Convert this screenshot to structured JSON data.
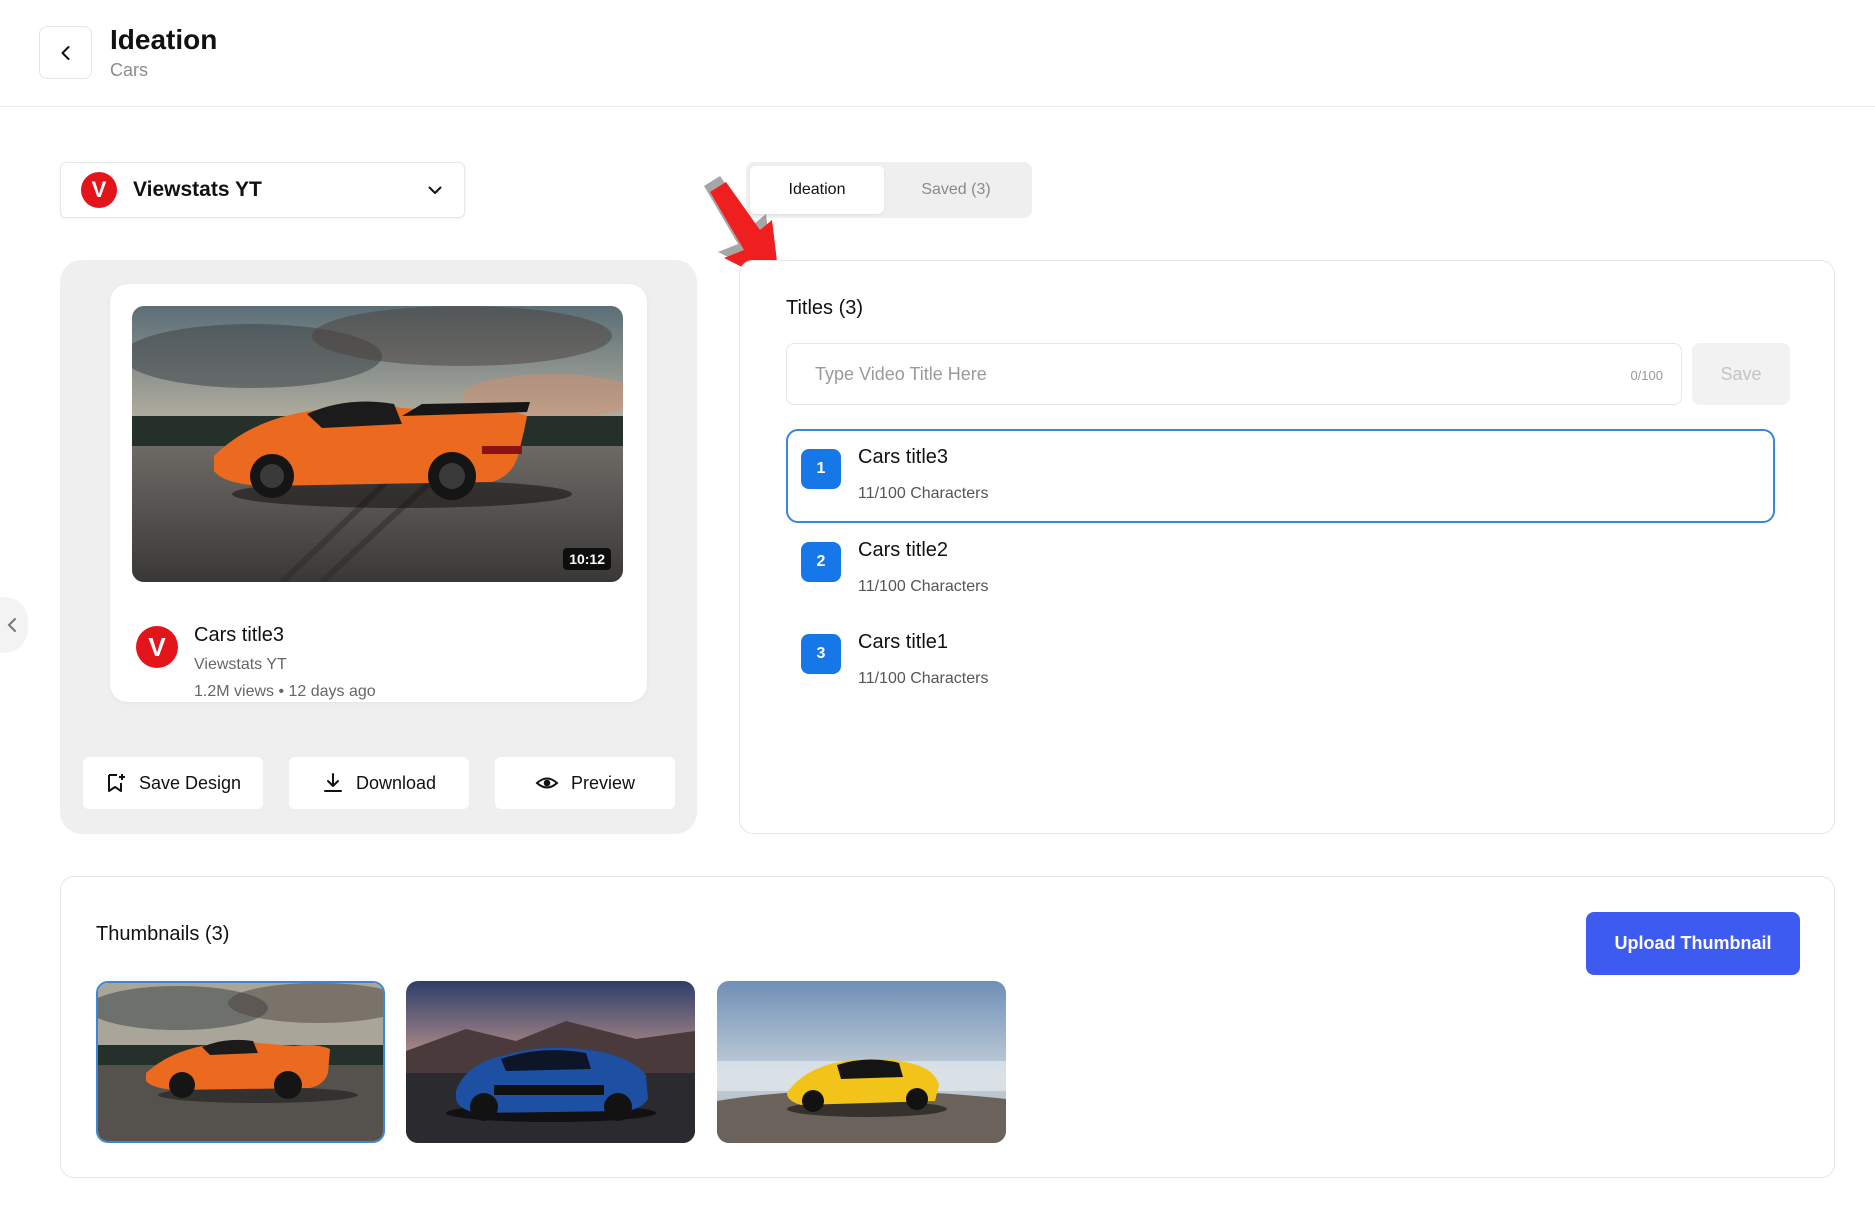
{
  "header": {
    "title": "Ideation",
    "subtitle": "Cars"
  },
  "channel_select": {
    "logo_letter": "V",
    "name": "Viewstats YT"
  },
  "tabs": [
    {
      "label": "Ideation",
      "active": true
    },
    {
      "label": "Saved (3)",
      "active": false
    }
  ],
  "video_card": {
    "duration": "10:12",
    "logo_letter": "V",
    "title": "Cars title3",
    "channel": "Viewstats YT",
    "meta": "1.2M views • 12 days ago"
  },
  "actions": {
    "save_design": "Save Design",
    "download": "Download",
    "preview": "Preview"
  },
  "titles": {
    "heading": "Titles (3)",
    "input_placeholder": "Type Video Title Here",
    "counter": "0/100",
    "save_label": "Save",
    "items": [
      {
        "number": "1",
        "title": "Cars title3",
        "chars": "11/100 Characters",
        "selected": true
      },
      {
        "number": "2",
        "title": "Cars title2",
        "chars": "11/100 Characters",
        "selected": false
      },
      {
        "number": "3",
        "title": "Cars title1",
        "chars": "11/100 Characters",
        "selected": false
      }
    ]
  },
  "thumbnails": {
    "heading": "Thumbnails (3)",
    "upload_label": "Upload Thumbnail",
    "items": [
      {
        "car_color": "#ec6a1f",
        "selected": true
      },
      {
        "car_color": "#1d4fa3",
        "selected": false
      },
      {
        "car_color": "#f2c318",
        "selected": false
      }
    ]
  },
  "colors": {
    "brand_red": "#e4141b",
    "accent_blue": "#1577e8",
    "upload_blue": "#3d5af1"
  }
}
